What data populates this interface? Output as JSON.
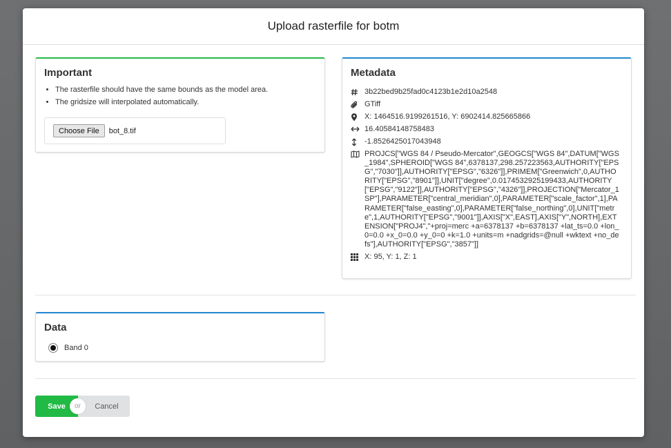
{
  "modal": {
    "title": "Upload rasterfile for botm"
  },
  "important": {
    "title": "Important",
    "notes": [
      "The rasterfile should have the same bounds as the model area.",
      "The gridsize will interpolated automatically."
    ],
    "file_button": "Choose File",
    "file_name": "bot_8.tif"
  },
  "metadata": {
    "title": "Metadata",
    "hash": "3b22bed9b25fad0c4123b1e2d10a2548",
    "driver": "GTiff",
    "origin": "X: 1464516.9199261516, Y: 6902414.825665866",
    "pixel_width": "16.40584148758483",
    "pixel_height": "-1.8526425017043948",
    "projection": "PROJCS[\"WGS 84 / Pseudo-Mercator\",GEOGCS[\"WGS 84\",DATUM[\"WGS_1984\",SPHEROID[\"WGS 84\",6378137,298.257223563,AUTHORITY[\"EPSG\",\"7030\"]],AUTHORITY[\"EPSG\",\"6326\"]],PRIMEM[\"Greenwich\",0,AUTHORITY[\"EPSG\",\"8901\"]],UNIT[\"degree\",0.0174532925199433,AUTHORITY[\"EPSG\",\"9122\"]],AUTHORITY[\"EPSG\",\"4326\"]],PROJECTION[\"Mercator_1SP\"],PARAMETER[\"central_meridian\",0],PARAMETER[\"scale_factor\",1],PARAMETER[\"false_easting\",0],PARAMETER[\"false_northing\",0],UNIT[\"metre\",1,AUTHORITY[\"EPSG\",\"9001\"]],AXIS[\"X\",EAST],AXIS[\"Y\",NORTH],EXTENSION[\"PROJ4\",\"+proj=merc +a=6378137 +b=6378137 +lat_ts=0.0 +lon_0=0.0 +x_0=0.0 +y_0=0 +k=1.0 +units=m +nadgrids=@null +wktext +no_defs\"],AUTHORITY[\"EPSG\",\"3857\"]]",
    "grid": "X: 95, Y: 1, Z: 1"
  },
  "data_section": {
    "title": "Data",
    "band_label": "Band 0"
  },
  "actions": {
    "save": "Save",
    "or": "or",
    "cancel": "Cancel"
  },
  "icons": {
    "hash": "hashtag-icon",
    "driver": "paperclip-icon",
    "origin": "map-marker-icon",
    "pixel_width": "arrows-horizontal-icon",
    "pixel_height": "arrows-vertical-icon",
    "projection": "map-icon",
    "grid": "grid-icon"
  },
  "colors": {
    "save_button": "#21ba45",
    "card_accent_green": "#21ba45",
    "card_accent_blue": "#2185d0"
  }
}
